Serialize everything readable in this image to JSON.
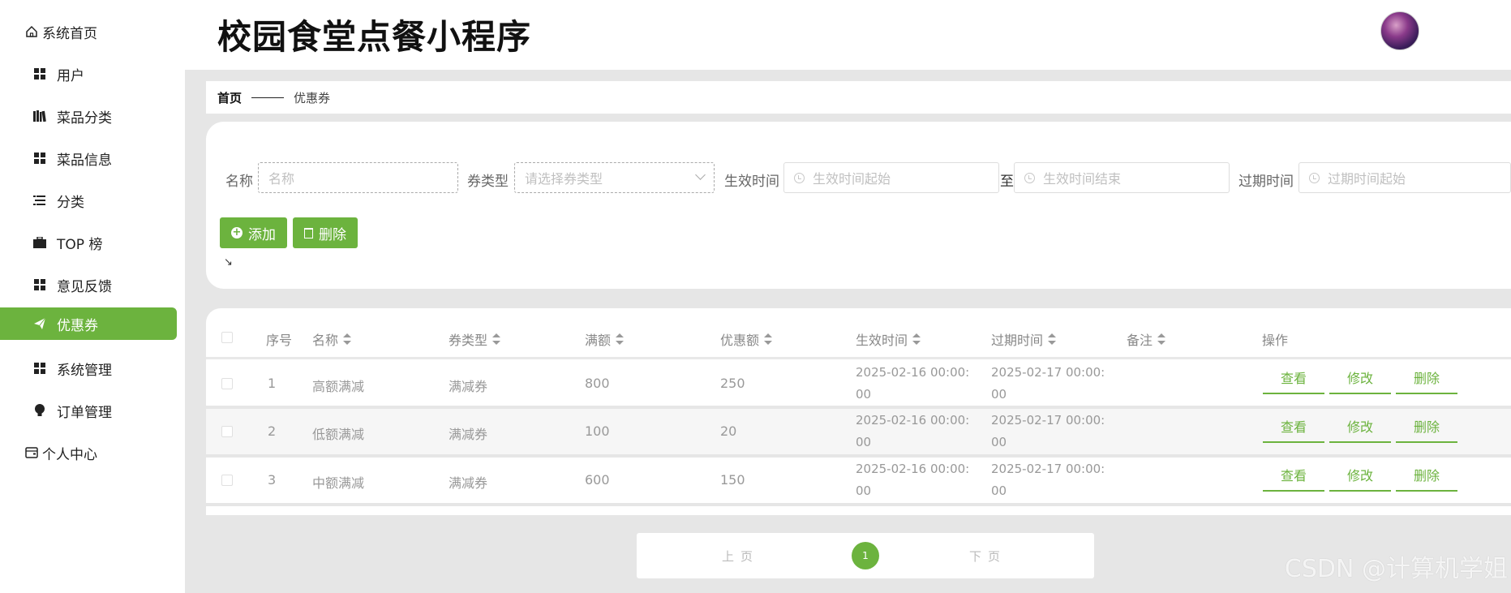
{
  "app_title": "校园食堂点餐小程序",
  "sidebar": {
    "home": "系统首页",
    "items": [
      "用户",
      "菜品分类",
      "菜品信息",
      "分类",
      "TOP 榜",
      "意见反馈",
      "优惠券",
      "系统管理",
      "订单管理"
    ],
    "active_item": "优惠券",
    "personal": "个人中心"
  },
  "breadcrumb": {
    "home": "首页",
    "current": "优惠券"
  },
  "search": {
    "name_label": "名称",
    "name_placeholder": "名称",
    "type_label": "券类型",
    "type_placeholder": "请选择券类型",
    "effective_label": "生效时间",
    "effective_start_placeholder": "生效时间起始",
    "to_label": "至",
    "effective_end_placeholder": "生效时间结束",
    "expire_label": "过期时间",
    "expire_start_placeholder": "过期时间起始"
  },
  "actions": {
    "add": "添加",
    "delete": "删除"
  },
  "table": {
    "headers": {
      "index": "序号",
      "name": "名称",
      "type": "券类型",
      "threshold": "满额",
      "discount": "优惠额",
      "effective": "生效时间",
      "expire": "过期时间",
      "note": "备注",
      "ops": "操作"
    },
    "rows": [
      {
        "index": "1",
        "name": "高额满减",
        "type": "满减券",
        "threshold": "800",
        "discount": "250",
        "effective_a": "2025-02-16 00:00:",
        "effective_b": "00",
        "expire_a": "2025-02-17 00:00:",
        "expire_b": "00",
        "note": ""
      },
      {
        "index": "2",
        "name": "低额满减",
        "type": "满减券",
        "threshold": "100",
        "discount": "20",
        "effective_a": "2025-02-16 00:00:",
        "effective_b": "00",
        "expire_a": "2025-02-17 00:00:",
        "expire_b": "00",
        "note": ""
      },
      {
        "index": "3",
        "name": "中额满减",
        "type": "满减券",
        "threshold": "600",
        "discount": "150",
        "effective_a": "2025-02-16 00:00:",
        "effective_b": "00",
        "expire_a": "2025-02-17 00:00:",
        "expire_b": "00",
        "note": ""
      }
    ],
    "op_view": "查看",
    "op_edit": "修改",
    "op_delete": "删除"
  },
  "pagination": {
    "prev": "上页",
    "current": "1",
    "next": "下页"
  },
  "watermark": "CSDN @计算机学姐",
  "colors": {
    "accent": "#6cb33e",
    "background": "#e6e6e6"
  }
}
